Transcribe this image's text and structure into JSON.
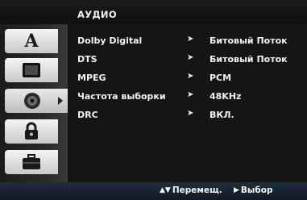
{
  "header": {
    "title": "АУДИО"
  },
  "sidebar": {
    "tabs": [
      {
        "name": "tab-language",
        "glyph": "A",
        "icon": "letter-a-icon"
      },
      {
        "name": "tab-display",
        "glyph": "",
        "icon": "tv-screen-icon"
      },
      {
        "name": "tab-audio",
        "glyph": "",
        "icon": "speaker-icon",
        "active": true
      },
      {
        "name": "tab-lock",
        "glyph": "",
        "icon": "padlock-icon"
      },
      {
        "name": "tab-other",
        "glyph": "",
        "icon": "briefcase-icon"
      }
    ]
  },
  "menu": {
    "rows": [
      {
        "label": "Dolby Digital",
        "value": "Битовый Поток"
      },
      {
        "label": "DTS",
        "value": "Битовый Поток"
      },
      {
        "label": "MPEG",
        "value": "PCM"
      },
      {
        "label": "Частота выборки",
        "value": "48KHz"
      },
      {
        "label": "DRC",
        "value": "ВКЛ."
      }
    ]
  },
  "footer": {
    "move_label": "Перемещ.",
    "select_label": "Выбор"
  }
}
